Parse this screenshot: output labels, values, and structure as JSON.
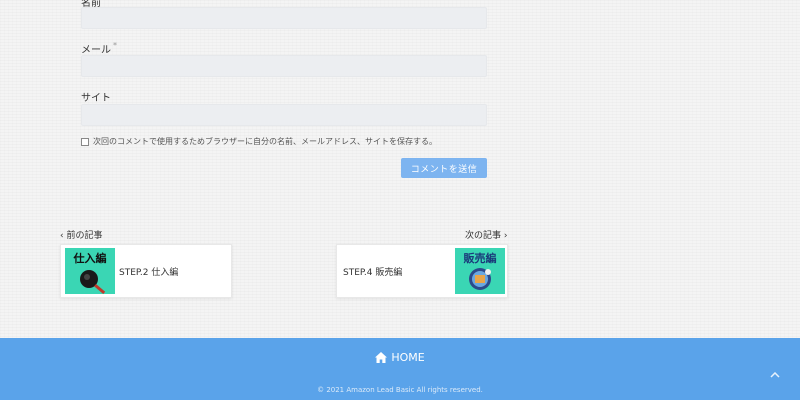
{
  "comment_form": {
    "name_label": "名前",
    "email_label": "メール",
    "email_required": "*",
    "site_label": "サイト",
    "save_info_text": "次回のコメントで使用するためブラウザーに自分の名前、メールアドレス、サイトを保存する。",
    "submit_label": "コメントを送信"
  },
  "post_nav": {
    "prev_label": "前の記事",
    "next_label": "次の記事",
    "prev_post": {
      "thumb_text": "仕入編",
      "title": "STEP.2 仕入編"
    },
    "next_post": {
      "thumb_text": "販売編",
      "title": "STEP.4 販売編"
    }
  },
  "footer": {
    "home_label": "HOME",
    "copyright": "© 2021 Amazon Lead Basic All rights reserved."
  },
  "colors": {
    "accent": "#5aa3ea",
    "button": "#7db4f0",
    "thumb_bg": "#3ad6b4"
  }
}
